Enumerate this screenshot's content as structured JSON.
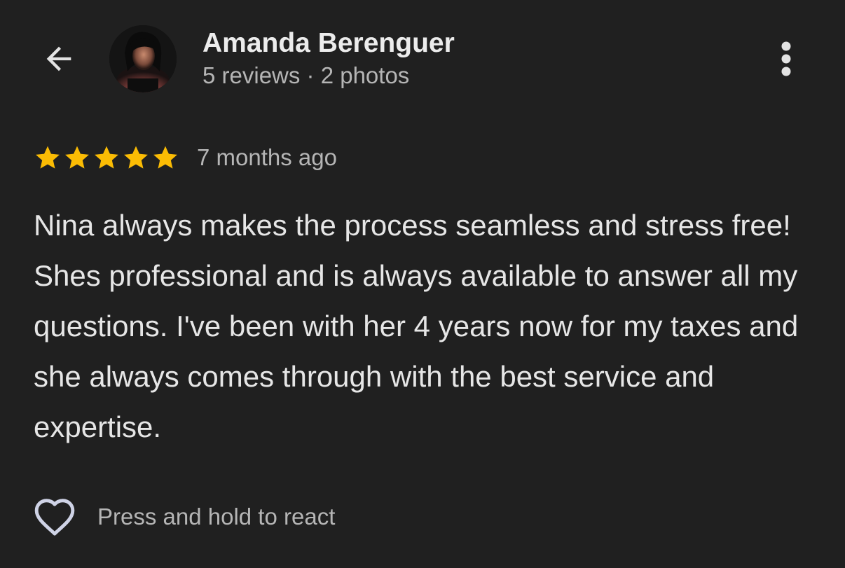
{
  "header": {
    "back_icon": "arrow-left-icon",
    "reviewer_name": "Amanda Berenguer",
    "reviewer_stats": "5 reviews · 2 photos",
    "more_icon": "more-vertical-icon"
  },
  "review": {
    "rating": 5,
    "rating_max": 5,
    "star_color": "#fbbc04",
    "time_ago": "7 months ago",
    "text": "Nina always makes the process seamless and stress free! Shes professional and is always available to answer all my questions. I've been with her 4 years now for my taxes and she always comes through with the best service and expertise."
  },
  "reaction": {
    "heart_icon": "heart-outline-icon",
    "hint": "Press and hold to react"
  },
  "colors": {
    "background": "#202020",
    "primary_text": "#e6e6e6",
    "secondary_text": "#b5b5b5"
  }
}
